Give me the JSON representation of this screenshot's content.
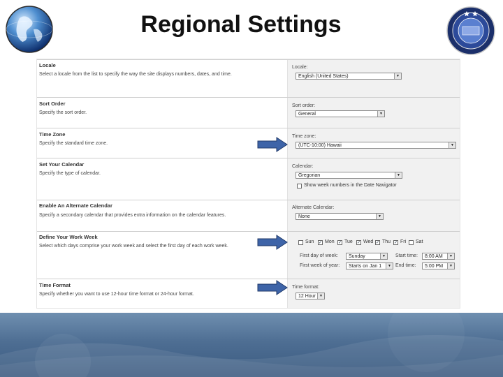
{
  "slide": {
    "title": "Regional Settings"
  },
  "sections": {
    "locale": {
      "title": "Locale",
      "description": "Select a locale from the list to specify the way the site displays numbers, dates, and time.",
      "field_label": "Locale:",
      "value": "English (United States)"
    },
    "sort_order": {
      "title": "Sort Order",
      "description": "Specify the sort order.",
      "field_label": "Sort order:",
      "value": "General"
    },
    "time_zone": {
      "title": "Time Zone",
      "description": "Specify the standard time zone.",
      "field_label": "Time zone:",
      "value": "(UTC-10:00) Hawaii"
    },
    "calendar": {
      "title": "Set Your Calendar",
      "description": "Specify the type of calendar.",
      "field_label": "Calendar:",
      "value": "Gregorian",
      "week_numbers_label": "Show week numbers in the Date Navigator",
      "week_numbers_checked": false
    },
    "alt_calendar": {
      "title": "Enable An Alternate Calendar",
      "description": "Specify a secondary calendar that provides extra information on the calendar features.",
      "field_label": "Alternate Calendar:",
      "value": "None"
    },
    "work_week": {
      "title": "Define Your Work Week",
      "description": "Select which days comprise your work week and select the first day of each work week.",
      "days": [
        {
          "label": "Sun",
          "checked": false
        },
        {
          "label": "Mon",
          "checked": true
        },
        {
          "label": "Tue",
          "checked": true
        },
        {
          "label": "Wed",
          "checked": true
        },
        {
          "label": "Thu",
          "checked": true
        },
        {
          "label": "Fri",
          "checked": true
        },
        {
          "label": "Sat",
          "checked": false
        }
      ],
      "first_day_label": "First day of week:",
      "first_day_value": "Sunday",
      "first_week_label": "First week of year:",
      "first_week_value": "Starts on Jan 1",
      "start_time_label": "Start time:",
      "start_time_value": "8:00 AM",
      "end_time_label": "End time:",
      "end_time_value": "5:00 PM"
    },
    "time_format": {
      "title": "Time Format",
      "description": "Specify whether you want to use 12-hour time format or 24-hour format.",
      "field_label": "Time format:",
      "value": "12 Hour"
    }
  },
  "colors": {
    "arrow_fill": "#3e64a8",
    "arrow_stroke": "#203a6a",
    "footer": "#4e6e93",
    "panel_bg": "#f1f1f1"
  },
  "icons": {
    "globe": "globe-logo-icon",
    "seal": "seal-logo-icon",
    "dropdown": "chevron-down-icon",
    "checkbox": "checkbox-icon",
    "arrow": "arrow-right-icon"
  }
}
